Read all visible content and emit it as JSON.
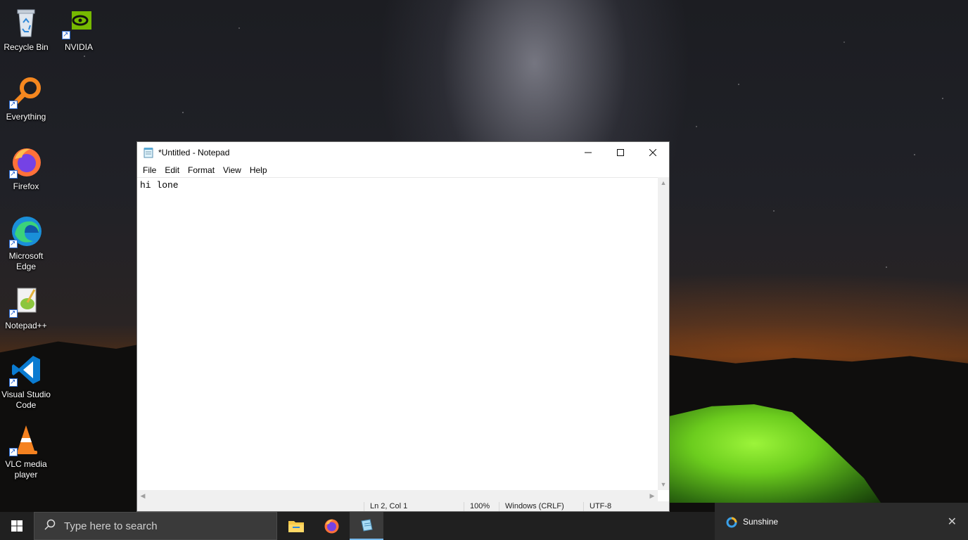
{
  "desktop": {
    "icons": [
      {
        "label": "Recycle Bin",
        "icon": "recycle-bin-icon"
      },
      {
        "label": "NVIDIA",
        "icon": "nvidia-icon"
      },
      {
        "label": "Everything",
        "icon": "everything-search-icon"
      },
      {
        "label": "Firefox",
        "icon": "firefox-icon"
      },
      {
        "label": "Microsoft Edge",
        "icon": "edge-icon"
      },
      {
        "label": "Notepad++",
        "icon": "notepadpp-icon"
      },
      {
        "label": "Visual Studio Code",
        "icon": "vscode-icon"
      },
      {
        "label": "VLC media player",
        "icon": "vlc-icon"
      }
    ]
  },
  "notepad": {
    "title": "*Untitled - Notepad",
    "menu": [
      "File",
      "Edit",
      "Format",
      "View",
      "Help"
    ],
    "content": "hi lone",
    "status": {
      "position": "Ln 2, Col 1",
      "zoom": "100%",
      "line_endings": "Windows (CRLF)",
      "encoding": "UTF-8"
    }
  },
  "taskbar": {
    "search_placeholder": "Type here to search",
    "apps": [
      "file-explorer-icon",
      "firefox-icon",
      "notepad-icon"
    ]
  },
  "notification": {
    "title": "Sunshine"
  },
  "colors": {
    "taskbar": "#202020",
    "active_accent": "#76b9ed",
    "nvidia_green": "#76b900"
  }
}
